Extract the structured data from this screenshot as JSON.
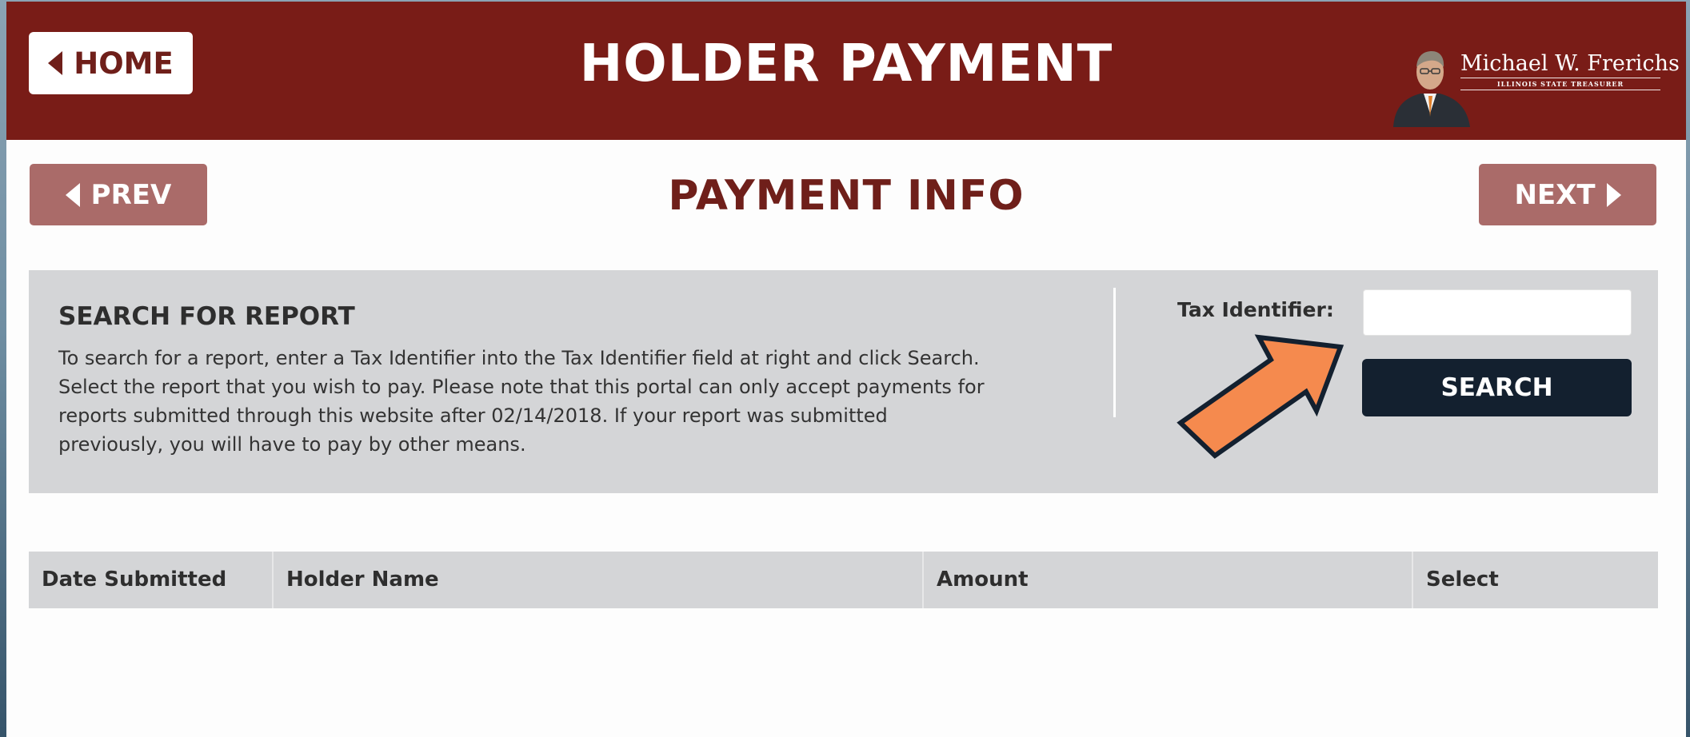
{
  "header": {
    "home_label": "HOME",
    "title": "HOLDER PAYMENT",
    "treasurer_name": "Michael W. Frerichs",
    "treasurer_office": "ILLINOIS STATE TREASURER"
  },
  "nav": {
    "prev_label": "PREV",
    "page_title": "PAYMENT INFO",
    "next_label": "NEXT"
  },
  "search": {
    "heading": "SEARCH FOR REPORT",
    "description": "To search for a report, enter a Tax Identifier into the Tax Identifier field at right and click Search. Select the report that you wish to pay. Please note that this portal can only accept payments for reports submitted through this website after 02/14/2018. If your report was submitted previously, you will have to pay by other means.",
    "tax_label": "Tax Identifier:",
    "tax_value": "",
    "button_label": "SEARCH"
  },
  "table": {
    "columns": [
      "Date Submitted",
      "Holder Name",
      "Amount",
      "Select"
    ],
    "rows": []
  },
  "icons": {
    "home": "caret-left-icon",
    "prev": "caret-left-icon",
    "next": "caret-right-icon",
    "annotation": "arrow-annotation-icon"
  },
  "colors": {
    "header_bg": "#791c17",
    "title_red": "#6f1f1a",
    "nav_button_bg": "#aa6b69",
    "panel_bg": "#d4d5d7",
    "search_button_bg": "#13202f",
    "arrow_fill": "#f58a4e"
  }
}
